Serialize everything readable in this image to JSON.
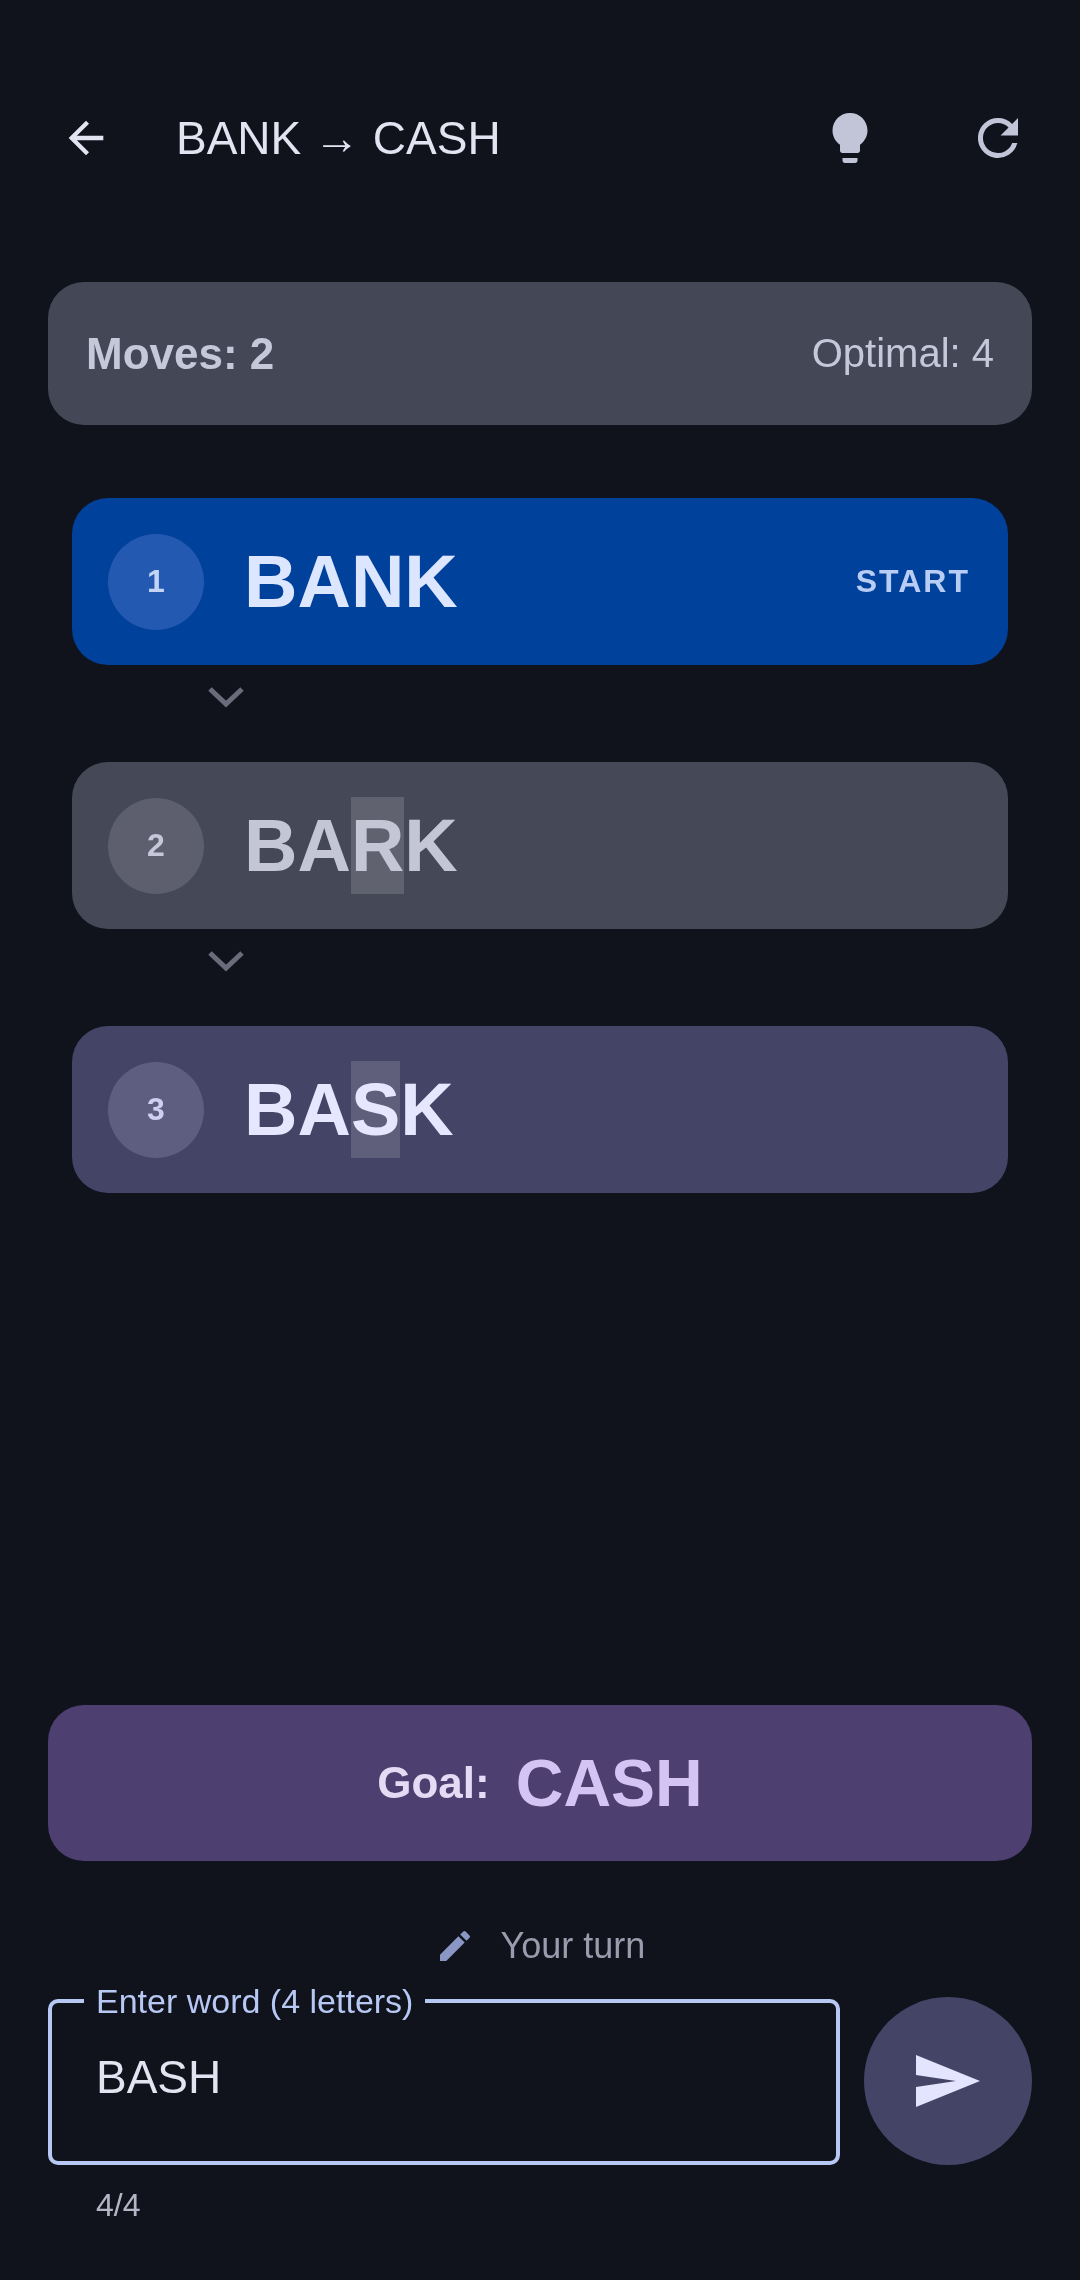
{
  "top_bar": {
    "title": "BANK → CASH"
  },
  "stats": {
    "moves": "Moves: 2",
    "optimal": "Optimal: 4"
  },
  "steps": [
    {
      "number": "1",
      "kind": "start",
      "badge": "START",
      "letters": [
        {
          "char": "B",
          "changed": false
        },
        {
          "char": "A",
          "changed": false
        },
        {
          "char": "N",
          "changed": false
        },
        {
          "char": "K",
          "changed": false
        }
      ]
    },
    {
      "number": "2",
      "kind": "past",
      "letters": [
        {
          "char": "B",
          "changed": false
        },
        {
          "char": "A",
          "changed": false
        },
        {
          "char": "R",
          "changed": true
        },
        {
          "char": "K",
          "changed": false
        }
      ]
    },
    {
      "number": "3",
      "kind": "current",
      "letters": [
        {
          "char": "B",
          "changed": false
        },
        {
          "char": "A",
          "changed": false
        },
        {
          "char": "S",
          "changed": true
        },
        {
          "char": "K",
          "changed": false
        }
      ]
    }
  ],
  "goal": {
    "label": "Goal:",
    "word": "CASH"
  },
  "status": "Your turn",
  "input": {
    "label": "Enter word (4 letters)",
    "value": "BASH",
    "counter": "4/4"
  }
}
